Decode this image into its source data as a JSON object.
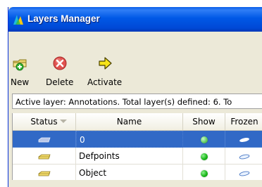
{
  "window": {
    "title": "Layers Manager"
  },
  "toolbar": {
    "new_label": "New",
    "delete_label": "Delete",
    "activate_label": "Activate"
  },
  "info": {
    "text": "Active layer: Annotations. Total layer(s) defined: 6. To"
  },
  "table": {
    "columns": [
      "Status",
      "Name",
      "Show",
      "Frozen"
    ],
    "rows": [
      {
        "name": "0",
        "show": "green-dot",
        "frozen": "unfrozen-icon",
        "selected": true
      },
      {
        "name": "Defpoints",
        "show": "green-dot",
        "frozen": "unfrozen-icon",
        "selected": false
      },
      {
        "name": "Object",
        "show": "green-dot",
        "frozen": "unfrozen-icon",
        "selected": false
      }
    ]
  },
  "colors": {
    "titlebar": "#0058e6",
    "selection": "#3169c6",
    "window_bg": "#ece9d8"
  }
}
